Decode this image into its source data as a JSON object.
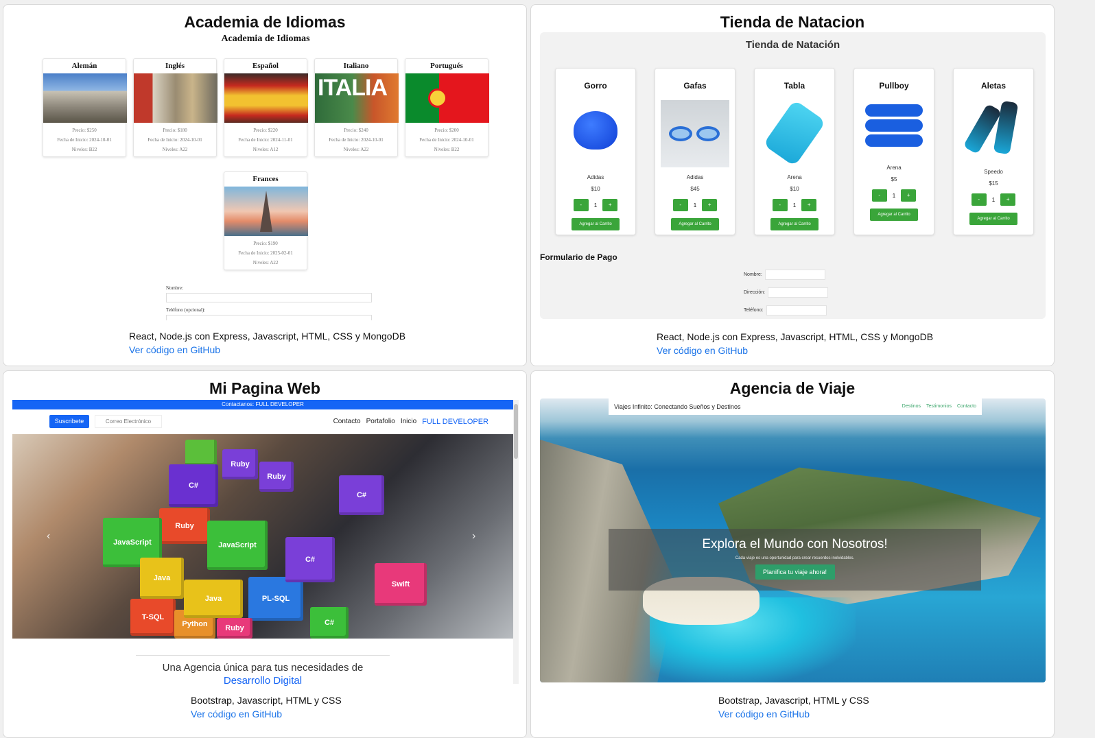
{
  "cards": [
    {
      "title": "Academia de Idiomas",
      "tech": "React, Node.js con Express, Javascript, HTML, CSS y MongoDB",
      "link": "Ver código en GitHub",
      "preview": {
        "heading": "Academia de Idiomas",
        "languages": [
          {
            "name": "Alemán",
            "price": "Precio: $250",
            "start": "Fecha de Inicio: 2024-10-01",
            "level": "Niveles: B22"
          },
          {
            "name": "Inglés",
            "price": "Precio: $180",
            "start": "Fecha de Inicio: 2024-10-01",
            "level": "Niveles: A22"
          },
          {
            "name": "Español",
            "price": "Precio: $220",
            "start": "Fecha de Inicio: 2024-11-01",
            "level": "Niveles: A12"
          },
          {
            "name": "Italiano",
            "price": "Precio: $240",
            "start": "Fecha de Inicio: 2024-10-01",
            "level": "Niveles: A22"
          },
          {
            "name": "Portugués",
            "price": "Precio: $200",
            "start": "Fecha de Inicio: 2024-10-01",
            "level": "Niveles: B22"
          },
          {
            "name": "Frances",
            "price": "Precio: $190",
            "start": "Fecha de Inicio: 2025-02-01",
            "level": "Niveles: A22"
          }
        ],
        "italia_text": "ITALIA",
        "form_name_label": "Nombre:",
        "form_phone_label": "Teléfono (opcional):"
      }
    },
    {
      "title": "Tienda de Natacion",
      "tech": "React, Node.js con Express, Javascript, HTML, CSS y MongoDB",
      "link": "Ver código en GitHub",
      "preview": {
        "heading": "Tienda de Natación",
        "products": [
          {
            "name": "Gorro",
            "brand": "Adidas",
            "price": "$10",
            "qty": "1"
          },
          {
            "name": "Gafas",
            "brand": "Adidas",
            "price": "$45",
            "qty": "1"
          },
          {
            "name": "Tabla",
            "brand": "Arena",
            "price": "$10",
            "qty": "1"
          },
          {
            "name": "Pullboy",
            "brand": "Arena",
            "price": "$5",
            "qty": "1"
          },
          {
            "name": "Aletas",
            "brand": "Speedo",
            "price": "$15",
            "qty": "1"
          }
        ],
        "minus": "-",
        "plus": "+",
        "add_label": "Agregar al Carrito",
        "pay_heading": "Formulario de Pago",
        "pay_name": "Nombre:",
        "pay_address": "Dirección:",
        "pay_phone": "Teléfono:"
      }
    },
    {
      "title": "Mi Pagina Web",
      "tech": "Bootstrap, Javascript, HTML y CSS",
      "link": "Ver código en GitHub",
      "preview": {
        "topbar": "Contactanos: FULL DEVELOPER",
        "subscribe": "Suscribete",
        "email_placeholder": "Correo Electrónico",
        "nav": [
          "Contacto",
          "Portafolio",
          "Inicio",
          "FULL DEVELOPER"
        ],
        "cubes": [
          "Ruby",
          "Ruby",
          "C#",
          "C#",
          "Ruby",
          "JavaScript",
          "JavaScript",
          "Java",
          "PL-SQL",
          "C#",
          "Swift",
          "T-SQL",
          "Python",
          "Java",
          "C#",
          "Ruby"
        ],
        "prev": "‹",
        "next": "›",
        "tagline_1": "Una Agencia única para tus necesidades de",
        "tagline_2": "Desarrollo Digital"
      }
    },
    {
      "title": "Agencia de Viaje",
      "tech": "Bootstrap, Javascript, HTML y CSS",
      "link": "Ver código en GitHub",
      "preview": {
        "brand": "Viajes Infinito: Conectando Sueños y Destinos",
        "nav": [
          "Destinos",
          "Testimonios",
          "Contacto"
        ],
        "hero_title": "Explora el Mundo con Nosotros!",
        "hero_sub": "Cada viaje es una oportunidad para crear recuerdos inolvidables.",
        "cta": "Planifica tu viaje ahora!"
      }
    }
  ],
  "colors": {
    "link": "#1a73e8",
    "green": "#3aa53a",
    "blue": "#1565f5",
    "teal": "#2e9e6a"
  }
}
